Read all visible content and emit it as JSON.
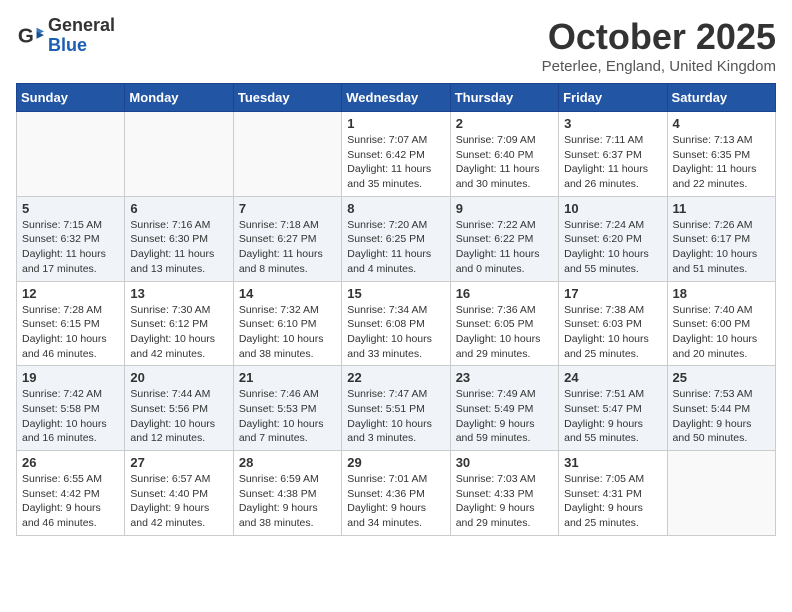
{
  "logo": {
    "general": "General",
    "blue": "Blue"
  },
  "title": "October 2025",
  "location": "Peterlee, England, United Kingdom",
  "days_of_week": [
    "Sunday",
    "Monday",
    "Tuesday",
    "Wednesday",
    "Thursday",
    "Friday",
    "Saturday"
  ],
  "weeks": [
    [
      {
        "day": "",
        "info": ""
      },
      {
        "day": "",
        "info": ""
      },
      {
        "day": "",
        "info": ""
      },
      {
        "day": "1",
        "info": "Sunrise: 7:07 AM\nSunset: 6:42 PM\nDaylight: 11 hours\nand 35 minutes."
      },
      {
        "day": "2",
        "info": "Sunrise: 7:09 AM\nSunset: 6:40 PM\nDaylight: 11 hours\nand 30 minutes."
      },
      {
        "day": "3",
        "info": "Sunrise: 7:11 AM\nSunset: 6:37 PM\nDaylight: 11 hours\nand 26 minutes."
      },
      {
        "day": "4",
        "info": "Sunrise: 7:13 AM\nSunset: 6:35 PM\nDaylight: 11 hours\nand 22 minutes."
      }
    ],
    [
      {
        "day": "5",
        "info": "Sunrise: 7:15 AM\nSunset: 6:32 PM\nDaylight: 11 hours\nand 17 minutes."
      },
      {
        "day": "6",
        "info": "Sunrise: 7:16 AM\nSunset: 6:30 PM\nDaylight: 11 hours\nand 13 minutes."
      },
      {
        "day": "7",
        "info": "Sunrise: 7:18 AM\nSunset: 6:27 PM\nDaylight: 11 hours\nand 8 minutes."
      },
      {
        "day": "8",
        "info": "Sunrise: 7:20 AM\nSunset: 6:25 PM\nDaylight: 11 hours\nand 4 minutes."
      },
      {
        "day": "9",
        "info": "Sunrise: 7:22 AM\nSunset: 6:22 PM\nDaylight: 11 hours\nand 0 minutes."
      },
      {
        "day": "10",
        "info": "Sunrise: 7:24 AM\nSunset: 6:20 PM\nDaylight: 10 hours\nand 55 minutes."
      },
      {
        "day": "11",
        "info": "Sunrise: 7:26 AM\nSunset: 6:17 PM\nDaylight: 10 hours\nand 51 minutes."
      }
    ],
    [
      {
        "day": "12",
        "info": "Sunrise: 7:28 AM\nSunset: 6:15 PM\nDaylight: 10 hours\nand 46 minutes."
      },
      {
        "day": "13",
        "info": "Sunrise: 7:30 AM\nSunset: 6:12 PM\nDaylight: 10 hours\nand 42 minutes."
      },
      {
        "day": "14",
        "info": "Sunrise: 7:32 AM\nSunset: 6:10 PM\nDaylight: 10 hours\nand 38 minutes."
      },
      {
        "day": "15",
        "info": "Sunrise: 7:34 AM\nSunset: 6:08 PM\nDaylight: 10 hours\nand 33 minutes."
      },
      {
        "day": "16",
        "info": "Sunrise: 7:36 AM\nSunset: 6:05 PM\nDaylight: 10 hours\nand 29 minutes."
      },
      {
        "day": "17",
        "info": "Sunrise: 7:38 AM\nSunset: 6:03 PM\nDaylight: 10 hours\nand 25 minutes."
      },
      {
        "day": "18",
        "info": "Sunrise: 7:40 AM\nSunset: 6:00 PM\nDaylight: 10 hours\nand 20 minutes."
      }
    ],
    [
      {
        "day": "19",
        "info": "Sunrise: 7:42 AM\nSunset: 5:58 PM\nDaylight: 10 hours\nand 16 minutes."
      },
      {
        "day": "20",
        "info": "Sunrise: 7:44 AM\nSunset: 5:56 PM\nDaylight: 10 hours\nand 12 minutes."
      },
      {
        "day": "21",
        "info": "Sunrise: 7:46 AM\nSunset: 5:53 PM\nDaylight: 10 hours\nand 7 minutes."
      },
      {
        "day": "22",
        "info": "Sunrise: 7:47 AM\nSunset: 5:51 PM\nDaylight: 10 hours\nand 3 minutes."
      },
      {
        "day": "23",
        "info": "Sunrise: 7:49 AM\nSunset: 5:49 PM\nDaylight: 9 hours\nand 59 minutes."
      },
      {
        "day": "24",
        "info": "Sunrise: 7:51 AM\nSunset: 5:47 PM\nDaylight: 9 hours\nand 55 minutes."
      },
      {
        "day": "25",
        "info": "Sunrise: 7:53 AM\nSunset: 5:44 PM\nDaylight: 9 hours\nand 50 minutes."
      }
    ],
    [
      {
        "day": "26",
        "info": "Sunrise: 6:55 AM\nSunset: 4:42 PM\nDaylight: 9 hours\nand 46 minutes."
      },
      {
        "day": "27",
        "info": "Sunrise: 6:57 AM\nSunset: 4:40 PM\nDaylight: 9 hours\nand 42 minutes."
      },
      {
        "day": "28",
        "info": "Sunrise: 6:59 AM\nSunset: 4:38 PM\nDaylight: 9 hours\nand 38 minutes."
      },
      {
        "day": "29",
        "info": "Sunrise: 7:01 AM\nSunset: 4:36 PM\nDaylight: 9 hours\nand 34 minutes."
      },
      {
        "day": "30",
        "info": "Sunrise: 7:03 AM\nSunset: 4:33 PM\nDaylight: 9 hours\nand 29 minutes."
      },
      {
        "day": "31",
        "info": "Sunrise: 7:05 AM\nSunset: 4:31 PM\nDaylight: 9 hours\nand 25 minutes."
      },
      {
        "day": "",
        "info": ""
      }
    ]
  ]
}
